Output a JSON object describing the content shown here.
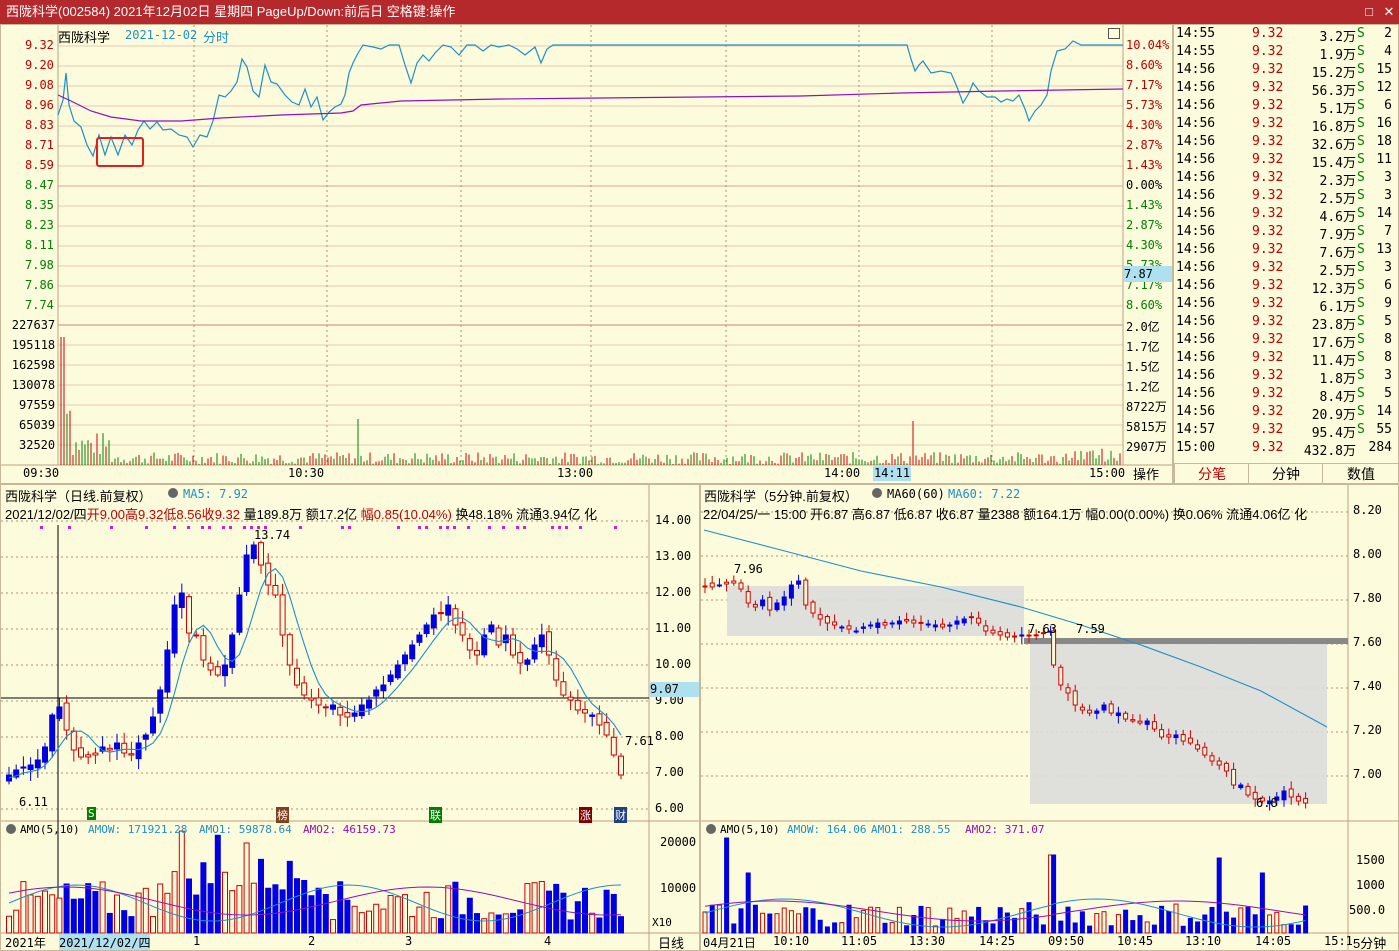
{
  "window": {
    "title": "西陇科学(002584) 2021年12月02日 星期四 PageUp/Down:前后日 空格键:操作",
    "btn_restore": "□",
    "btn_close": "✕"
  },
  "colors": {
    "up": "#d00000",
    "down": "#0000e0",
    "price_line": "#1e90c8",
    "avg_line": "#9010c0",
    "grid": "#d8c8a8",
    "bg": "#fcfbdc",
    "red_text": "#c00000",
    "green_text": "#008000"
  },
  "intraday": {
    "name": "西陇科学",
    "date": "2021-12-02",
    "mode": "分时",
    "left_prices": [
      "9.32",
      "9.20",
      "9.08",
      "8.96",
      "8.83",
      "8.71",
      "8.59",
      "8.47",
      "8.35",
      "8.23",
      "8.11",
      "7.98",
      "7.86",
      "7.74"
    ],
    "right_pcts": [
      "10.04%",
      "8.60%",
      "7.17%",
      "5.73%",
      "4.30%",
      "2.87%",
      "1.43%",
      "0.00%",
      "1.43%",
      "2.87%",
      "4.30%",
      "5.73%",
      "7.17%",
      "8.60%"
    ],
    "cursor_price": "7.87",
    "vol_left": [
      "227637",
      "195118",
      "162598",
      "130078",
      "97559",
      "65039",
      "32520"
    ],
    "vol_right": [
      "2.0亿",
      "1.7亿",
      "1.5亿",
      "1.2亿",
      "8722万",
      "5815万",
      "2907万"
    ],
    "times": [
      "09:30",
      "10:30",
      "13:00",
      "14:00",
      "15:00"
    ],
    "cursor_time": "14:11",
    "ops_label": "操作"
  },
  "trades": {
    "rows": [
      [
        "14:55",
        "9.32",
        "3.2万",
        "S",
        "2"
      ],
      [
        "14:55",
        "9.32",
        "1.9万",
        "S",
        "4"
      ],
      [
        "14:56",
        "9.32",
        "15.2万",
        "S",
        "15"
      ],
      [
        "14:56",
        "9.32",
        "56.3万",
        "S",
        "12"
      ],
      [
        "14:56",
        "9.32",
        "5.1万",
        "S",
        "6"
      ],
      [
        "14:56",
        "9.32",
        "16.8万",
        "S",
        "16"
      ],
      [
        "14:56",
        "9.32",
        "32.6万",
        "S",
        "18"
      ],
      [
        "14:56",
        "9.32",
        "15.4万",
        "S",
        "11"
      ],
      [
        "14:56",
        "9.32",
        "2.3万",
        "S",
        "3"
      ],
      [
        "14:56",
        "9.32",
        "2.5万",
        "S",
        "3"
      ],
      [
        "14:56",
        "9.32",
        "4.6万",
        "S",
        "14"
      ],
      [
        "14:56",
        "9.32",
        "7.9万",
        "S",
        "7"
      ],
      [
        "14:56",
        "9.32",
        "7.6万",
        "S",
        "13"
      ],
      [
        "14:56",
        "9.32",
        "2.5万",
        "S",
        "3"
      ],
      [
        "14:56",
        "9.32",
        "12.3万",
        "S",
        "6"
      ],
      [
        "14:56",
        "9.32",
        "6.1万",
        "S",
        "9"
      ],
      [
        "14:56",
        "9.32",
        "23.8万",
        "S",
        "5"
      ],
      [
        "14:56",
        "9.32",
        "17.6万",
        "S",
        "8"
      ],
      [
        "14:56",
        "9.32",
        "11.4万",
        "S",
        "8"
      ],
      [
        "14:56",
        "9.32",
        "1.8万",
        "S",
        "3"
      ],
      [
        "14:56",
        "9.32",
        "8.4万",
        "S",
        "5"
      ],
      [
        "14:56",
        "9.32",
        "20.9万",
        "S",
        "14"
      ],
      [
        "14:57",
        "9.32",
        "95.4万",
        "S",
        "55"
      ],
      [
        "15:00",
        "9.32",
        "432.8万",
        "",
        "284"
      ]
    ],
    "tabs": [
      "分笔",
      "分钟",
      "数值"
    ]
  },
  "daily": {
    "title": "西陇科学（日线.前复权）",
    "ma_label": "MA5: 7.92",
    "info": {
      "date": "2021/12/02/四",
      "open_l": "开",
      "open": "9.00",
      "high_l": "高",
      "high": "9.32",
      "low_l": "低",
      "low": "8.56",
      "close_l": "收",
      "close": "9.32",
      "vol": "量189.8万",
      "amt": "额17.2亿",
      "amp_l": "幅",
      "amp": "0.85(10.04%)",
      "turn": "换48.18%",
      "float": "流通3.94亿",
      "extra": "化"
    },
    "y_labels": [
      "14.00",
      "13.00",
      "12.00",
      "11.00",
      "10.00",
      "9.00",
      "8.00",
      "7.00",
      "6.00"
    ],
    "cursor_price": "9.07",
    "hi_label": "13.74",
    "lo_label": "6.11",
    "last_label": "7.61",
    "events": [
      "S",
      "榜",
      "联",
      "涨",
      "财"
    ],
    "amo": {
      "name": "AMO(5,10)",
      "amow": "AMOW: 171921.28",
      "amo1": "AMO1: 59878.64",
      "amo2": "AMO2: 46159.73"
    },
    "amo_labels": [
      "20000",
      "10000"
    ],
    "amo_unit": "X10",
    "x_labels": [
      "2021年",
      "2021/12/02/四",
      "1",
      "2",
      "3",
      "4"
    ],
    "period": "日线"
  },
  "min5": {
    "title": "西陇科学（5分钟.前复权）",
    "ma_label": "MA60(60)",
    "ma_val": "MA60: 7.22",
    "info": "22/04/25/一  15:00 开6.87 高6.87 低6.87 收6.87 量2388 额164.1万 幅0.00(0.00%) 换0.06% 流通4.06亿 化",
    "y_labels": [
      "8.20",
      "8.00",
      "7.80",
      "7.60",
      "7.40",
      "7.20",
      "7.00"
    ],
    "hi_label": "7.96",
    "label_a": "7.63",
    "label_b": "7.59",
    "lo_label": "6.8",
    "amo": {
      "name": "AMO(5,10)",
      "amow": "AMOW: 164.06",
      "amo1": "AMO1: 288.55",
      "amo2": "AMO2: 371.07"
    },
    "amo_labels": [
      "1500",
      "1000",
      "500.0"
    ],
    "x_labels": [
      "04月21日",
      "10:10",
      "11:05",
      "13:30",
      "14:25",
      "09:50",
      "10:45",
      "13:10",
      "14:05",
      "15:1"
    ],
    "period": "5分钟"
  }
}
